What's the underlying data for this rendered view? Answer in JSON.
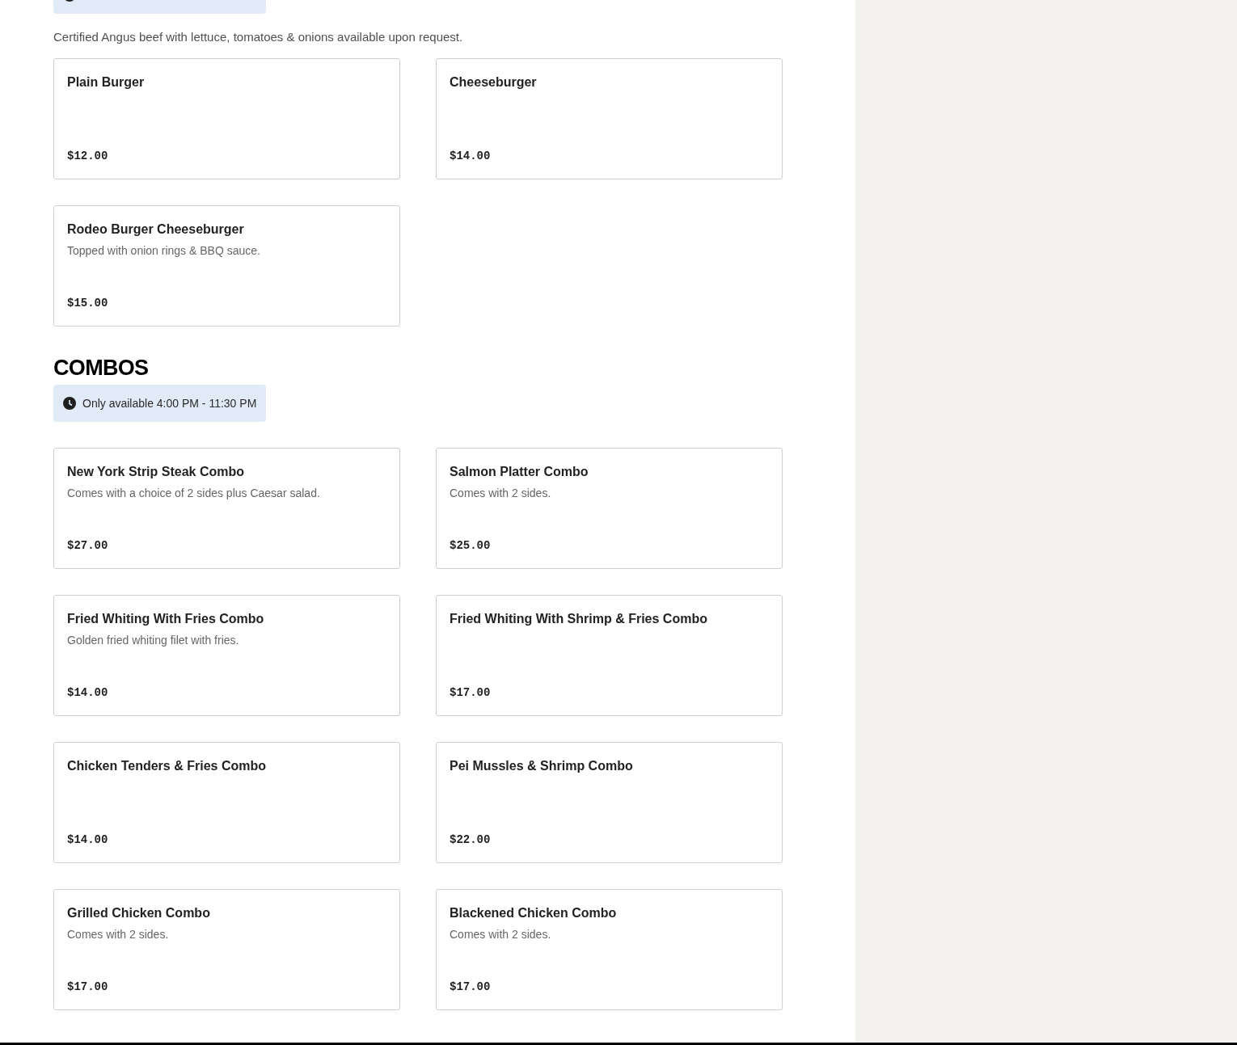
{
  "burgers": {
    "description": "Certified Angus beef with lettuce, tomatoes & onions available upon request.",
    "items": [
      {
        "name": "Plain Burger",
        "price": "$12.00"
      },
      {
        "name": "Cheeseburger",
        "price": "$14.00"
      },
      {
        "name": "Rodeo Burger Cheeseburger",
        "description": "Topped with onion rings & BBQ sauce.",
        "price": "$15.00"
      }
    ]
  },
  "combos": {
    "title": "COMBOS",
    "availability": "Only available 4:00 PM - 11:30 PM",
    "items": [
      {
        "name": "New York Strip Steak Combo",
        "description": "Comes with a choice of 2 sides plus Caesar salad.",
        "price": "$27.00"
      },
      {
        "name": "Salmon Platter Combo",
        "description": "Comes with 2 sides.",
        "price": "$25.00"
      },
      {
        "name": "Fried Whiting With Fries Combo",
        "description": "Golden fried whiting filet with fries.",
        "price": "$14.00"
      },
      {
        "name": "Fried Whiting With Shrimp & Fries Combo",
        "price": "$17.00"
      },
      {
        "name": "Chicken Tenders & Fries Combo",
        "price": "$14.00"
      },
      {
        "name": "Pei Mussles & Shrimp Combo",
        "price": "$22.00"
      },
      {
        "name": "Grilled Chicken Combo",
        "description": "Comes with 2 sides.",
        "price": "$17.00"
      },
      {
        "name": "Blackened Chicken Combo",
        "description": "Comes with 2 sides.",
        "price": "$17.00"
      }
    ]
  }
}
